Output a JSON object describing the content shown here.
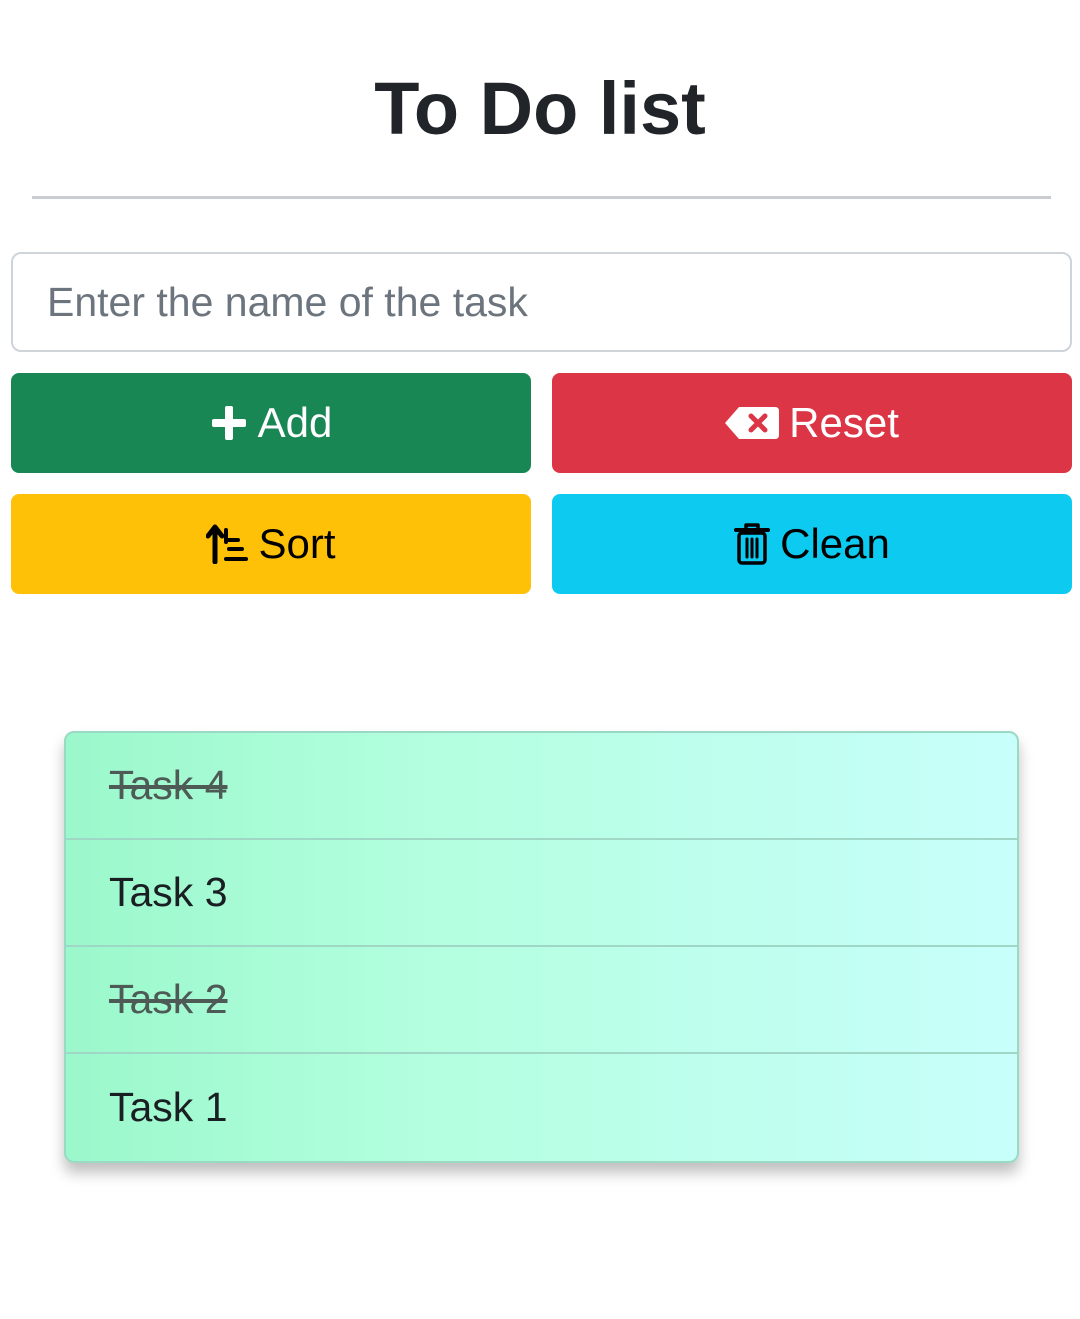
{
  "header": {
    "title": "To Do list"
  },
  "input": {
    "placeholder": "Enter the name of the task",
    "value": ""
  },
  "buttons": {
    "add": {
      "label": "Add",
      "icon": "plus-icon",
      "color": "#198754"
    },
    "reset": {
      "label": "Reset",
      "icon": "backspace-icon",
      "color": "#dc3545"
    },
    "sort": {
      "label": "Sort",
      "icon": "sort-ascending-icon",
      "color": "#ffc107"
    },
    "clean": {
      "label": "Clean",
      "icon": "trash-icon",
      "color": "#0dcaf0"
    }
  },
  "tasks": [
    {
      "label": "Task 4",
      "done": true
    },
    {
      "label": "Task 3",
      "done": false
    },
    {
      "label": "Task 2",
      "done": true
    },
    {
      "label": "Task 1",
      "done": false
    }
  ]
}
